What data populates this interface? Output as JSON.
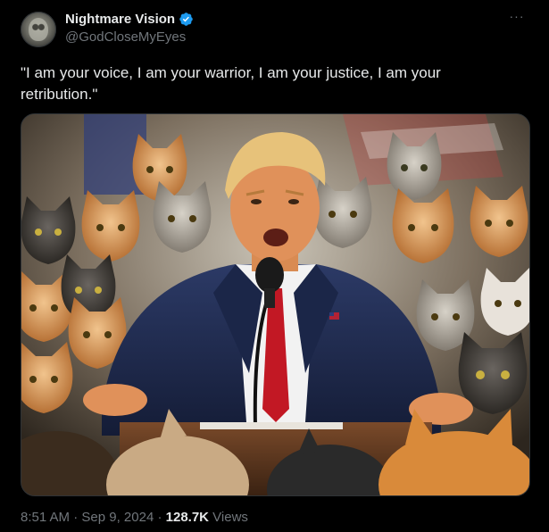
{
  "author": {
    "display_name": "Nightmare Vision",
    "handle": "@GodCloseMyEyes",
    "verified": true,
    "verified_badge_color": "#1d9bf0",
    "avatar_icon": "avatar-image"
  },
  "menu": {
    "icon": "more-dots-icon",
    "glyph": "···"
  },
  "tweet": {
    "text": "\"I am your voice, I am your warrior, I am your justice, I am your retribution.\""
  },
  "media": {
    "icon": "tweet-image"
  },
  "meta": {
    "time": "8:51 AM",
    "sep1": " · ",
    "date": "Sep 9, 2024",
    "sep2": " · ",
    "views_count": "128.7K",
    "views_label": " Views"
  },
  "colors": {
    "background": "#000000",
    "primary_text": "#e7e9ea",
    "secondary_text": "#71767b",
    "border": "#2f3336"
  }
}
